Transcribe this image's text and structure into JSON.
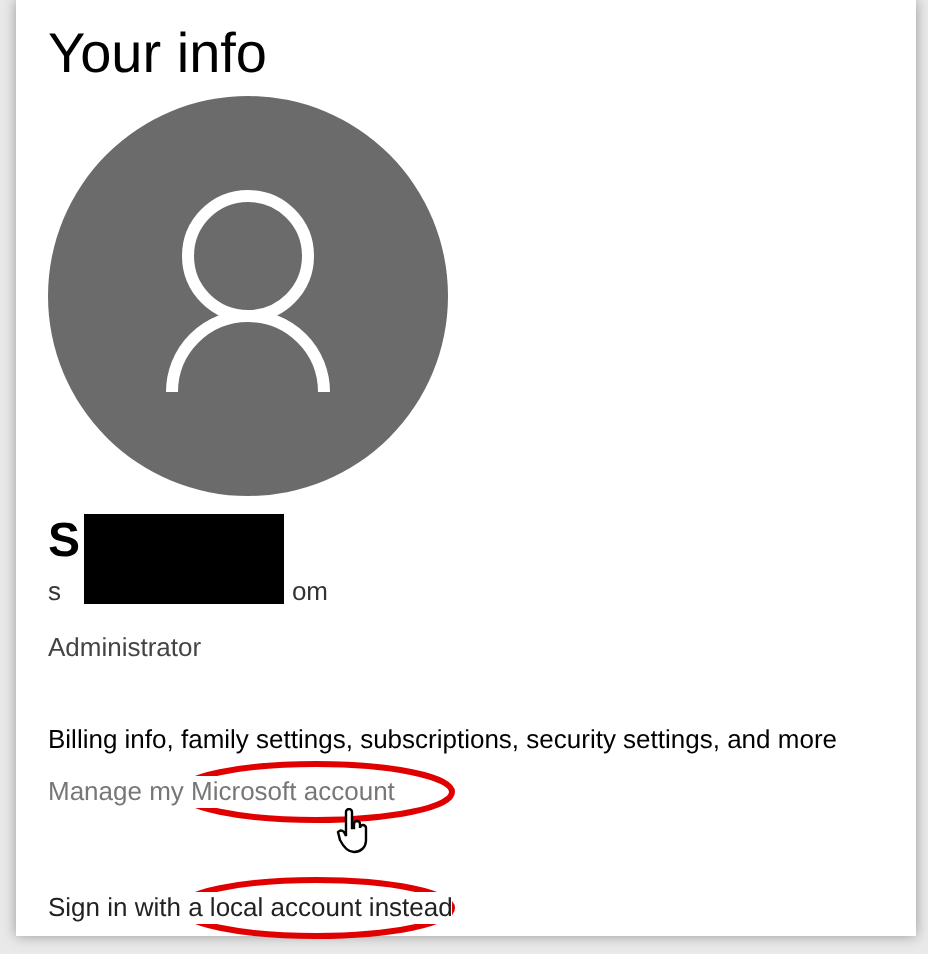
{
  "title": "Your info",
  "account": {
    "name": "S",
    "email_start": "s",
    "email_end": "om",
    "role": "Administrator"
  },
  "billing_text": "Billing info, family settings, subscriptions, security settings, and more",
  "manage_link": "Manage my Microsoft account",
  "local_link": "Sign in with a local account instead"
}
